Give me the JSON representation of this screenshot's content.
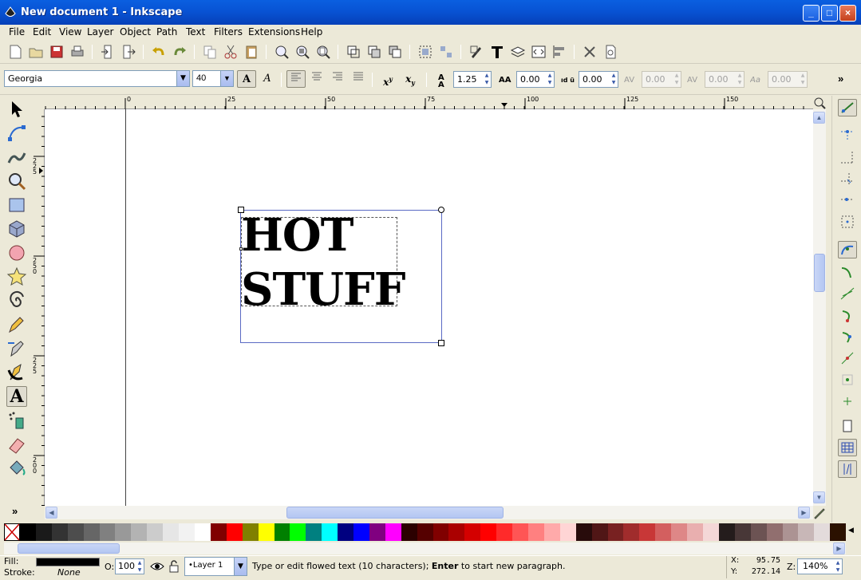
{
  "window": {
    "title": "New document 1 - Inkscape",
    "minimize": "_",
    "maximize": "□",
    "close": "×"
  },
  "menu": [
    "File",
    "Edit",
    "View",
    "Layer",
    "Object",
    "Path",
    "Text",
    "Filters",
    "Extensions",
    "Help"
  ],
  "text_toolbar": {
    "font_family": "Georgia",
    "font_size": "40",
    "bold_label": "A",
    "italic_label": "A",
    "superscript_label": "x",
    "superscript_sup": "y",
    "subscript_label": "x",
    "subscript_sub": "y",
    "line_spacing": "1.25",
    "letter_spacing": "0.00",
    "word_spacing": "0.00",
    "kerning": "0.00",
    "vertical_shift": "0.00",
    "rotation": "0.00",
    "more": "»"
  },
  "ruler": {
    "h_labels": [
      "0",
      "25",
      "50",
      "75",
      "100",
      "125",
      "150"
    ],
    "v_labels": [
      "225",
      "250",
      "225",
      "200"
    ]
  },
  "canvas": {
    "text_line1": "HOT",
    "text_line2": "STUFF"
  },
  "toolbox_more": "»",
  "palette": [
    "#000000",
    "#1a1a1a",
    "#333333",
    "#4d4d4d",
    "#666666",
    "#808080",
    "#999999",
    "#b3b3b3",
    "#cccccc",
    "#e6e6e6",
    "#f2f2f2",
    "#ffffff",
    "#800000",
    "#ff0000",
    "#808000",
    "#ffff00",
    "#008000",
    "#00ff00",
    "#008080",
    "#00ffff",
    "#000080",
    "#0000ff",
    "#800080",
    "#ff00ff",
    "#2b0000",
    "#550000",
    "#800000",
    "#aa0000",
    "#d40000",
    "#ff0000",
    "#ff2a2a",
    "#ff5555",
    "#ff8080",
    "#ffaaaa",
    "#ffd5d5",
    "#280b0b",
    "#501616",
    "#782121",
    "#a02c2c",
    "#c83737",
    "#d35f5f",
    "#de8787",
    "#e9afaf",
    "#f4d7d7",
    "#241c1c",
    "#483737",
    "#6c5353",
    "#916f6f",
    "#ac9393",
    "#c8b7b7",
    "#e3dbdb",
    "#2b1100"
  ],
  "status": {
    "fill_label": "Fill:",
    "stroke_label": "Stroke:",
    "stroke_value": "None",
    "fill_color": "#000000",
    "opacity_label": "O:",
    "opacity_value": "100",
    "layer": "•Layer 1",
    "message_pre": "Type or edit flowed text (10 characters); ",
    "message_bold": "Enter",
    "message_post": " to start new paragraph.",
    "x_label": "X:",
    "x_value": "95.75",
    "y_label": "Y:",
    "y_value": "272.14",
    "zoom_label": "Z:",
    "zoom_value": "140%"
  }
}
